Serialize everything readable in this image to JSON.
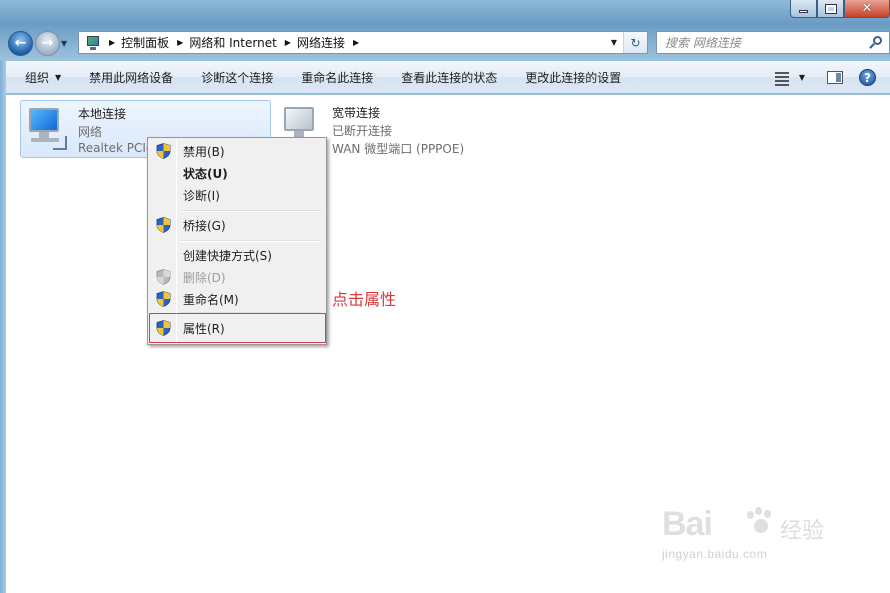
{
  "window": {
    "close_glyph": "✕"
  },
  "nav": {
    "breadcrumb": [
      "控制面板",
      "网络和 Internet",
      "网络连接"
    ],
    "search_placeholder": "搜索 网络连接"
  },
  "toolbar": {
    "organize": "组织",
    "disable": "禁用此网络设备",
    "diagnose": "诊断这个连接",
    "rename": "重命名此连接",
    "view_status": "查看此连接的状态",
    "change_settings": "更改此连接的设置"
  },
  "connections": [
    {
      "name": "本地连接",
      "status": "网络",
      "device": "Realtek PCIe",
      "icon": "network-adapter-icon"
    },
    {
      "name": "宽带连接",
      "status": "已断开连接",
      "device": "WAN 微型端口 (PPPOE)",
      "icon": "broadband-adapter-icon"
    }
  ],
  "context_menu": {
    "items": [
      {
        "label": "禁用(B)",
        "shield": true
      },
      {
        "label": "状态(U)",
        "bold": true
      },
      {
        "label": "诊断(I)"
      },
      {
        "label": "桥接(G)",
        "shield": true
      },
      {
        "label": "创建快捷方式(S)"
      },
      {
        "label": "删除(D)",
        "shield": true,
        "disabled": true
      },
      {
        "label": "重命名(M)",
        "shield": true
      },
      {
        "label": "属性(R)",
        "shield": true,
        "highlighted": true
      }
    ]
  },
  "annotation": "点击属性",
  "watermark": {
    "logo_left": "Bai",
    "logo_right": "经验",
    "url": "jingyan.baidu.com"
  },
  "colors": {
    "annotation": "#d7383c",
    "highlight_border": "#d33f4a"
  }
}
